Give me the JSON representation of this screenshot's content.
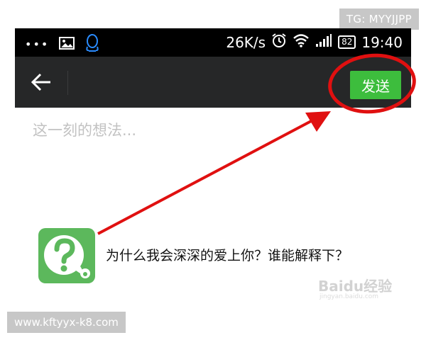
{
  "watermark_top": "TG: MYYJJPP",
  "watermark_bottom": "www.kftyyx-k8.com",
  "status_bar": {
    "dots": "•••",
    "network_speed": "26K/s",
    "battery_level": "82",
    "time": "19:40"
  },
  "title_bar": {
    "send_label": "发送"
  },
  "compose": {
    "placeholder": "这一刻的想法..."
  },
  "shared_item": {
    "title": "为什么我会深深的爱上你？谁能解释下？"
  },
  "baidu_watermark": {
    "logo": "Baidu经验",
    "url": "jingyan.baidu.com"
  },
  "colors": {
    "status_bar_bg": "#000000",
    "title_bar_bg": "#262728",
    "send_button": "#3dbd3d",
    "annotation_red": "#e01010",
    "app_icon_green": "#5cb85c"
  }
}
